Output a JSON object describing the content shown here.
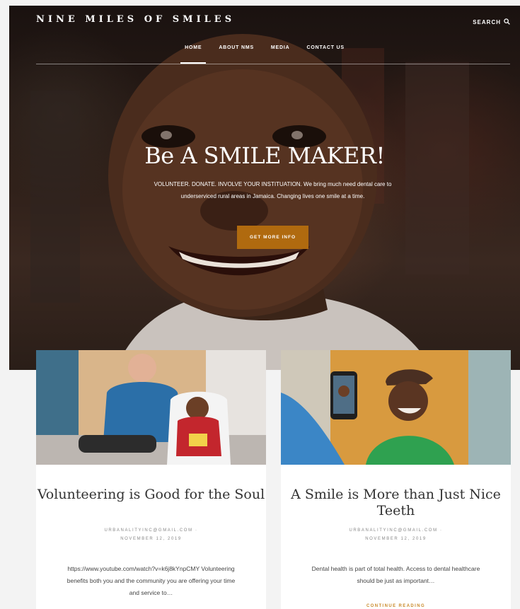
{
  "site": {
    "title": "NINE MILES OF SMILES",
    "search_label": "SEARCH"
  },
  "nav": {
    "items": [
      {
        "label": "HOME",
        "active": true
      },
      {
        "label": "ABOUT NMS",
        "active": false
      },
      {
        "label": "MEDIA",
        "active": false
      },
      {
        "label": "CONTACT US",
        "active": false
      }
    ]
  },
  "hero": {
    "heading": "Be A SMILE MAKER!",
    "text": "VOLUNTEER. DONATE. INVOLVE YOUR INSTITUATION. We bring much need dental care to underserviced rural areas in Jamaica. Changing lives one smile at a time.",
    "cta_label": "GET MORE INFO"
  },
  "posts": [
    {
      "title": "Volunteering is Good for the Soul",
      "author": "URBANALITYINC@GMAIL.COM ·",
      "date": "NOVEMBER 12, 2019",
      "excerpt": "https://www.youtube.com/watch?v=k6j8kYnpCMY Volunteering benefits both you and the community you are offering your time and service to…"
    },
    {
      "title": "A Smile is More than Just Nice Teeth",
      "author": "URBANALITYINC@GMAIL.COM ·",
      "date": "NOVEMBER 12, 2019",
      "excerpt": "Dental health is part of total health. Access to dental healthcare should be just as important…",
      "more_label": "CONTINUE READING"
    }
  ],
  "colors": {
    "accent": "#b06a0f",
    "link": "#c98a2a"
  }
}
